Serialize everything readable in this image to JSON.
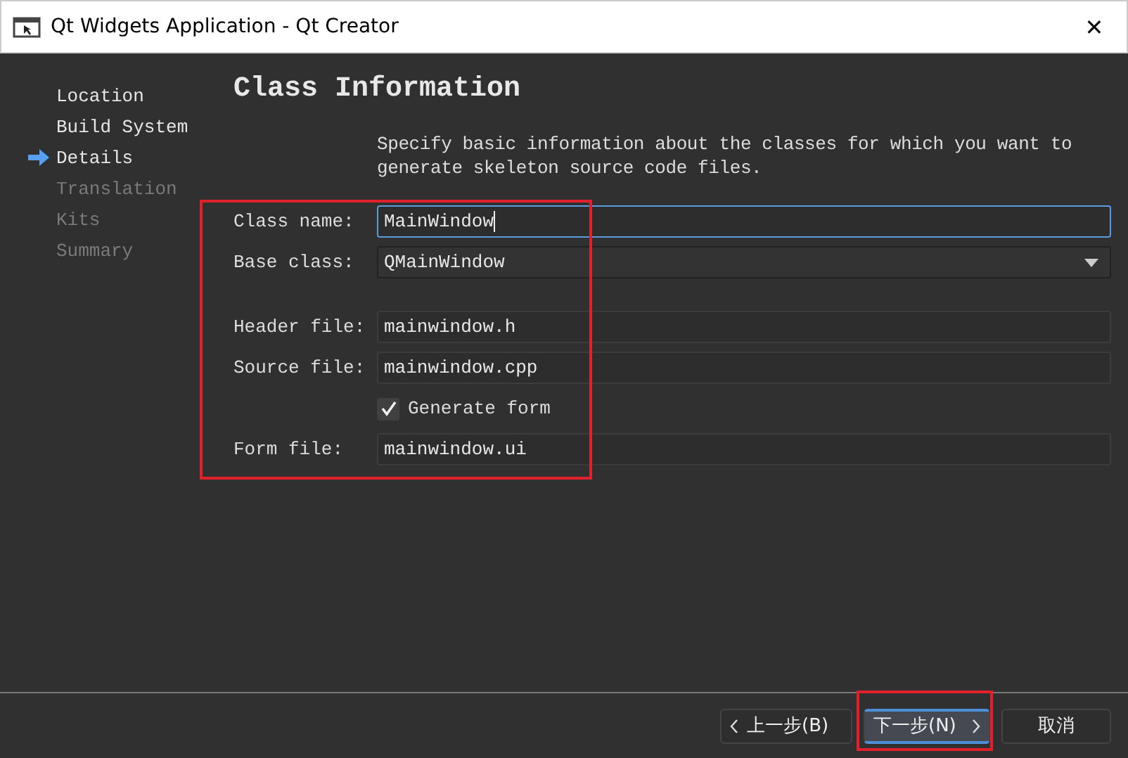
{
  "window": {
    "title": "Qt Widgets Application - Qt Creator",
    "close": "✕"
  },
  "steps": [
    {
      "label": "Location",
      "selected": false,
      "disabled": false
    },
    {
      "label": "Build System",
      "selected": false,
      "disabled": false
    },
    {
      "label": "Details",
      "selected": true,
      "disabled": false
    },
    {
      "label": "Translation",
      "selected": false,
      "disabled": true
    },
    {
      "label": "Kits",
      "selected": false,
      "disabled": true
    },
    {
      "label": "Summary",
      "selected": false,
      "disabled": true
    }
  ],
  "page": {
    "title": "Class Information",
    "description": "Specify basic information about the classes for which you want to generate skeleton source code files."
  },
  "fields": [
    {
      "kind": "text",
      "label": "Class name:",
      "value": "MainWindow",
      "focused": true
    },
    {
      "kind": "combo",
      "label": "Base class:",
      "value": "QMainWindow",
      "focused": false
    },
    {
      "kind": "spacer"
    },
    {
      "kind": "text",
      "label": "Header file:",
      "value": "mainwindow.h",
      "focused": false
    },
    {
      "kind": "text",
      "label": "Source file:",
      "value": "mainwindow.cpp",
      "focused": false
    },
    {
      "kind": "check",
      "label": "Generate form",
      "checked": true
    },
    {
      "kind": "text",
      "label": "Form file:",
      "value": "mainwindow.ui",
      "focused": false
    }
  ],
  "buttons": [
    {
      "label": "上一步(B)",
      "kind": "back",
      "default": false
    },
    {
      "label": "下一步(N)",
      "kind": "next",
      "default": true
    },
    {
      "label": "取消",
      "kind": "plain",
      "default": false
    }
  ]
}
